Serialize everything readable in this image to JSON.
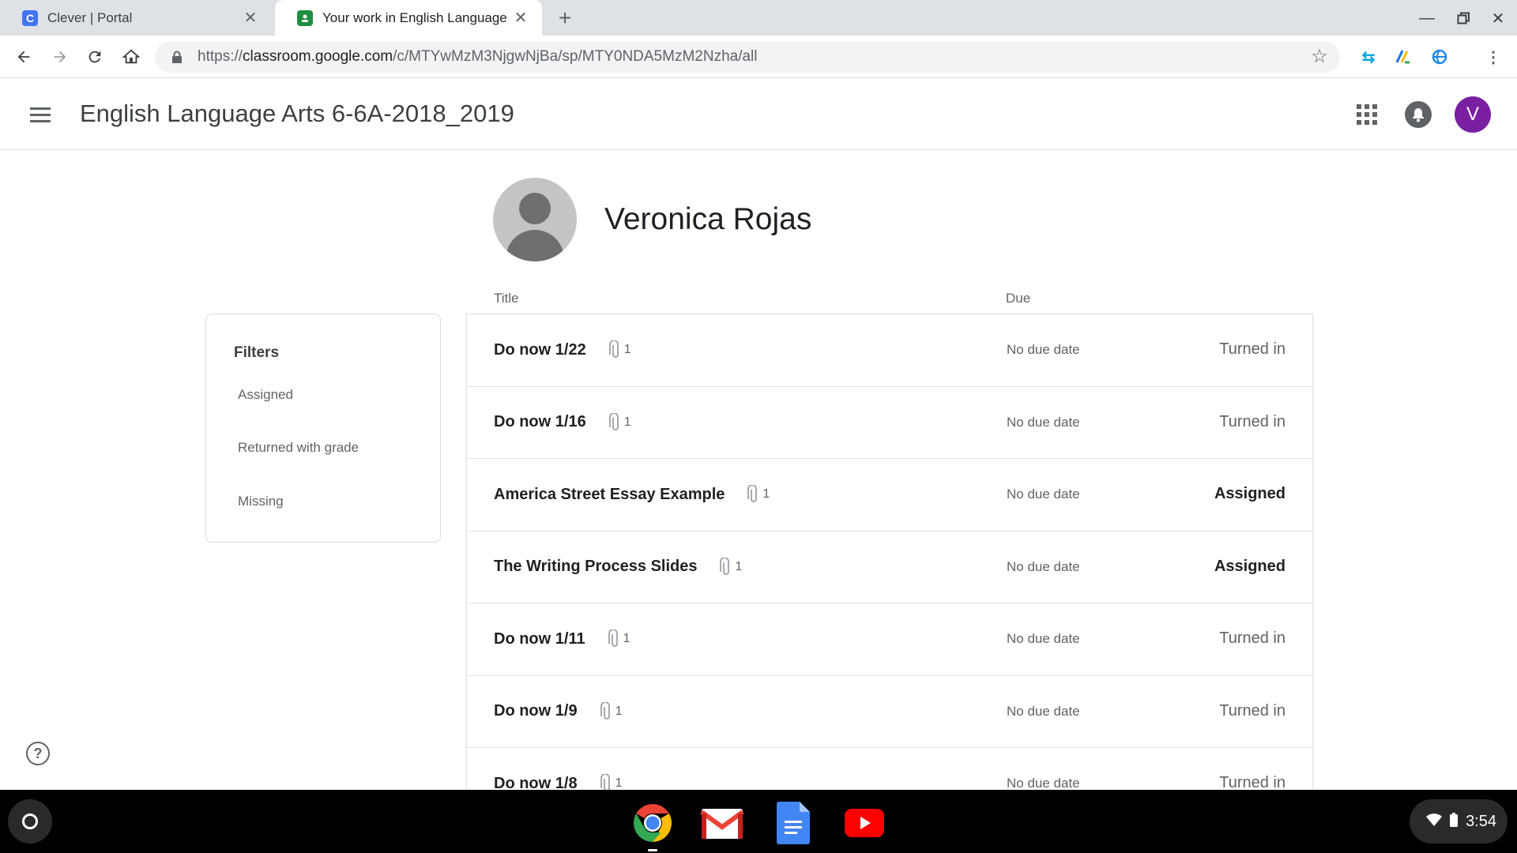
{
  "browser": {
    "tabs": [
      {
        "title": "Clever | Portal",
        "favicon": "C",
        "active": false
      },
      {
        "title": "Your work in English Language A",
        "favicon": "classroom-icon",
        "active": true
      }
    ],
    "url": {
      "scheme": "https://",
      "host": "classroom.google.com",
      "path": "/c/MTYwMzM3NjgwNjBa/sp/MTY0NDA5MzM2Nzha/all"
    }
  },
  "header": {
    "class_title": "English Language Arts 6-6A-2018_2019",
    "avatar_letter": "V"
  },
  "student": {
    "name": "Veronica Rojas"
  },
  "columns": {
    "title": "Title",
    "due": "Due"
  },
  "filters": {
    "title": "Filters",
    "items": [
      "Assigned",
      "Returned with grade",
      "Missing"
    ]
  },
  "work": [
    {
      "title": "Do now 1/22",
      "attachments": "1",
      "due": "No due date",
      "status": "Turned in"
    },
    {
      "title": "Do now 1/16",
      "attachments": "1",
      "due": "No due date",
      "status": "Turned in"
    },
    {
      "title": "America Street Essay Example",
      "attachments": "1",
      "due": "No due date",
      "status": "Assigned"
    },
    {
      "title": "The Writing Process Slides",
      "attachments": "1",
      "due": "No due date",
      "status": "Assigned"
    },
    {
      "title": "Do now 1/11",
      "attachments": "1",
      "due": "No due date",
      "status": "Turned in"
    },
    {
      "title": "Do now 1/9",
      "attachments": "1",
      "due": "No due date",
      "status": "Turned in"
    },
    {
      "title": "Do now 1/8",
      "attachments": "1",
      "due": "No due date",
      "status": "Turned in"
    }
  ],
  "shelf": {
    "apps": [
      "chrome-icon",
      "gmail-icon",
      "docs-icon",
      "youtube-icon"
    ],
    "clock": "3:54"
  },
  "colors": {
    "accent": "#7b1fa2",
    "clever": "#4274f6",
    "classroom": "#1e8e3e"
  }
}
